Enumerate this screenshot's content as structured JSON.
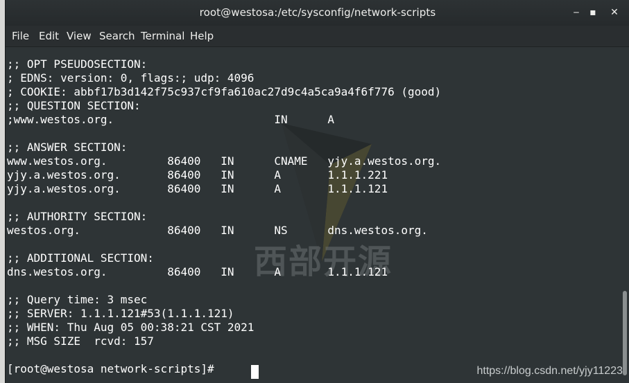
{
  "window": {
    "title": "root@westosa:/etc/sysconfig/network-scripts",
    "controls": {
      "minimize": "‒",
      "maximize": "▪",
      "close": "✕"
    }
  },
  "menubar": {
    "items": [
      "File",
      "Edit",
      "View",
      "Search",
      "Terminal",
      "Help"
    ]
  },
  "terminal": {
    "lines": [
      ";; OPT PSEUDOSECTION:",
      "; EDNS: version: 0, flags:; udp: 4096",
      "; COOKIE: abbf17b3d142f75c937cf9fa610ac27d9c4a5ca9a4f6f776 (good)",
      ";; QUESTION SECTION:",
      ";www.westos.org.                        IN      A",
      "",
      ";; ANSWER SECTION:",
      "www.westos.org.         86400   IN      CNAME   yjy.a.westos.org.",
      "yjy.a.westos.org.       86400   IN      A       1.1.1.221",
      "yjy.a.westos.org.       86400   IN      A       1.1.1.121",
      "",
      ";; AUTHORITY SECTION:",
      "westos.org.             86400   IN      NS      dns.westos.org.",
      "",
      ";; ADDITIONAL SECTION:",
      "dns.westos.org.         86400   IN      A       1.1.1.121",
      "",
      ";; Query time: 3 msec",
      ";; SERVER: 1.1.1.121#53(1.1.1.121)",
      ";; WHEN: Thu Aug 05 00:38:21 CST 2021",
      ";; MSG SIZE  rcvd: 157",
      "",
      "[root@westosa network-scripts]# "
    ]
  },
  "watermark": {
    "chinese": "西部开源",
    "url": "https://blog.csdn.net/yjy11223"
  }
}
